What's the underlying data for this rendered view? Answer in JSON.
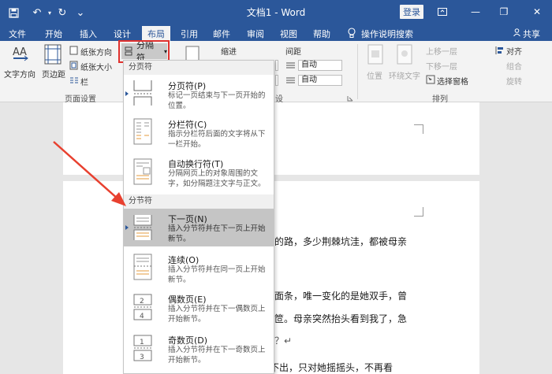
{
  "titlebar": {
    "doc_title": "文档1 - Word",
    "login": "登录",
    "save_icon": "save-icon",
    "undo_glyph": "↶",
    "redo_glyph": "↻",
    "more_glyph": "⌄",
    "minimize_glyph": "—",
    "restore_glyph": "❐",
    "close_glyph": "✕"
  },
  "tabs": [
    "文件",
    "开始",
    "插入",
    "设计",
    "布局",
    "引用",
    "邮件",
    "审阅",
    "视图",
    "帮助"
  ],
  "active_tab": "布局",
  "tell_me": "操作说明搜索",
  "share": "共享",
  "ribbon": {
    "text_direction": "文字方向",
    "margins": "页边距",
    "orientation": "纸张方向",
    "size": "纸张大小",
    "columns": "栏",
    "page_setup": "页面设置",
    "breaks": "分隔符",
    "indent": "缩进",
    "spacing": "间距",
    "spacing_before": "自动",
    "spacing_after": "自动",
    "paragraph": "设",
    "position": "位置",
    "wrap_text": "环绕文字",
    "bring_forward": "上移一层",
    "send_backward": "下移一层",
    "selection_pane": "选择窗格",
    "align": "对齐",
    "group": "组合",
    "rotate": "旋转",
    "arrange": "排列"
  },
  "menu": {
    "page_breaks_header": "分页符",
    "section_breaks_header": "分节符",
    "items": [
      {
        "title": "分页符(P)",
        "desc": "标记一页结束与下一页开始的位置。"
      },
      {
        "title": "分栏符(C)",
        "desc": "指示分栏符后面的文字将从下一栏开始。"
      },
      {
        "title": "自动换行符(T)",
        "desc": "分隔网页上的对象周围的文字，如分隔题注文字与正文。"
      },
      {
        "title": "下一页(N)",
        "desc": "插入分节符并在下一页上开始新节。"
      },
      {
        "title": "连续(O)",
        "desc": "插入分节符并在同一页上开始新节。"
      },
      {
        "title": "偶数页(E)",
        "desc": "插入分节符并在下一偶数页上开始新节。"
      },
      {
        "title": "奇数页(D)",
        "desc": "插入分节符并在下一奇数页上开始新节。"
      }
    ]
  },
  "document": {
    "line1": "的路，多少荆棘坑洼，都被母亲",
    "line2": "面条，唯一变化的是她双手，曾",
    "line3": "笸。母亲突然抬头看到我了，急",
    "line4": "？↵",
    "line5": "我慌忙之间连句完整的话也说不出，只对她摇摇头，不再看"
  },
  "colors": {
    "title_blue": "#2b579a",
    "highlight_red": "#e0312e",
    "arrow_red": "#e8402f"
  }
}
